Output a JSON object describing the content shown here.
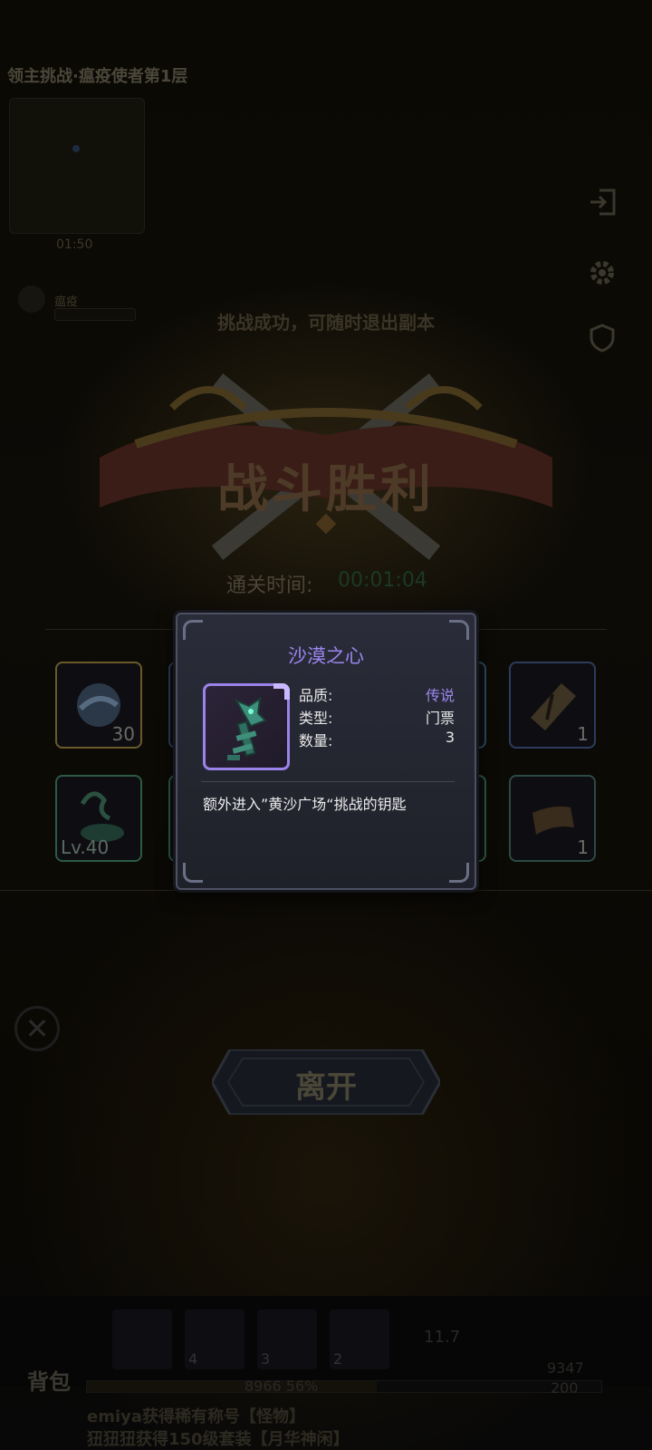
{
  "stage_title": "领主挑战·瘟疫使者第1层",
  "minimap_time": "01:50",
  "boss_label": "瘟疫",
  "success_message": "挑战成功，可随时退出副本",
  "victory_banner": "战斗胜利",
  "clear_time": {
    "label": "通关时间:",
    "value": "00:01:04"
  },
  "rewards_row1": [
    {
      "count": "30",
      "border": "#6a5a2a",
      "icon": "orb-icon"
    },
    {
      "count": "1",
      "border": "#2c3c5c",
      "icon": "scroll-icon"
    }
  ],
  "rewards_row2": [
    {
      "level": "Lv.40",
      "border": "#2c5a44",
      "icon": "pet-icon"
    },
    {
      "count": "1",
      "border": "#2c4a44",
      "icon": "cloth-icon"
    }
  ],
  "leave_button": "离开",
  "close_glyph": "✕",
  "bottom": {
    "bag_label": "背包",
    "exp_text": "8966 56%",
    "level_value": "200",
    "hp_value": "9347",
    "skill_counts": [
      "4",
      "3",
      "2"
    ],
    "skill_extra": "11.7",
    "chat_line1": "emiya获得稀有称号【怪物】",
    "chat_line2": "狃狃狃获得150级套装【月华神闲】"
  },
  "popup": {
    "title": "沙漠之心",
    "item_icon": "desert-key-icon",
    "quality_label": "品质:",
    "quality_value": "传说",
    "type_label": "类型:",
    "type_value": "门票",
    "quantity_label": "数量:",
    "quantity_value": "3",
    "description": "额外进入”黄沙广场“挑战的钥匙"
  }
}
